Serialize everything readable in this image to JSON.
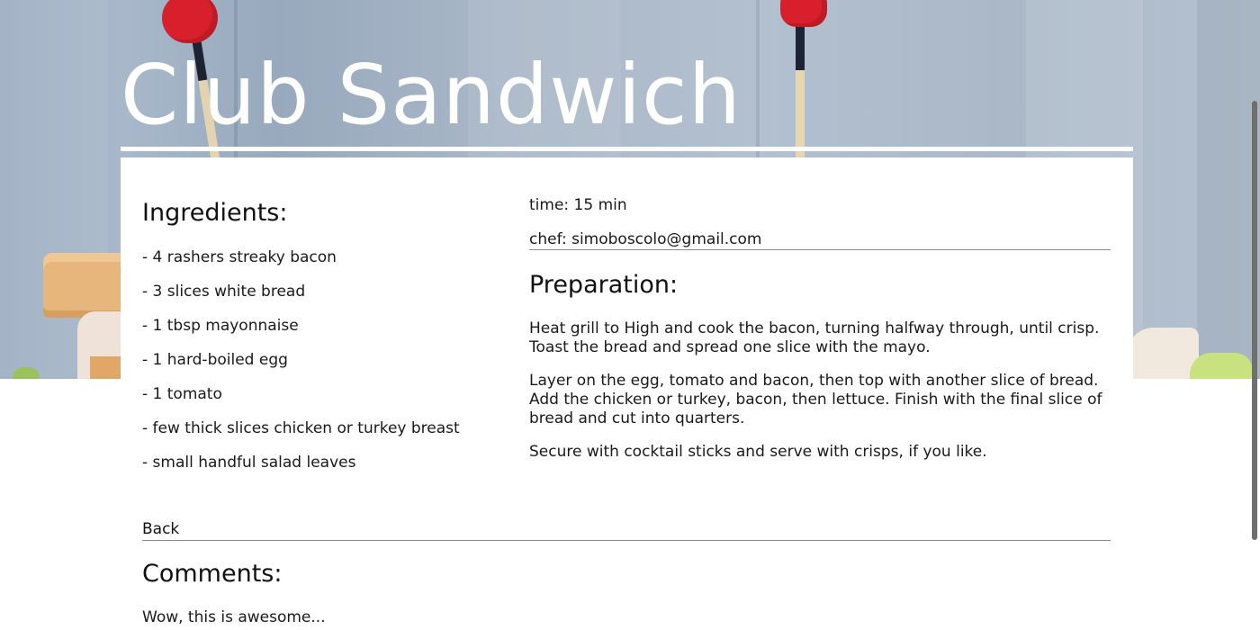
{
  "page": {
    "title": "Club Sandwich"
  },
  "ingredients": {
    "heading": "Ingredients:",
    "items": [
      "- 4 rashers streaky bacon",
      "- 3 slices white bread",
      "- 1 tbsp mayonnaise",
      "- 1 hard-boiled egg",
      "- 1 tomato",
      "- few thick slices chicken or turkey breast",
      "- small handful salad leaves"
    ]
  },
  "meta": {
    "time": "time: 15 min",
    "chef": "chef: simoboscolo@gmail.com"
  },
  "preparation": {
    "heading": "Preparation:",
    "paragraphs": [
      "Heat grill to High and cook the bacon, turning halfway through, until crisp. Toast the bread and spread one slice with the mayo.",
      "Layer on the egg, tomato and bacon, then top with another slice of bread. Add the chicken or turkey, bacon, then lettuce. Finish with the final slice of bread and cut into quarters.",
      "Secure with cocktail sticks and serve with crisps, if you like."
    ]
  },
  "navigation": {
    "back_label": "Back"
  },
  "comments": {
    "heading": "Comments:",
    "items": [
      "Wow, this is awesome..."
    ]
  },
  "colors": {
    "title_text": "#ffffff",
    "body_text": "#111111",
    "rule": "#8a8a8a",
    "hero_tint": "#a8b8ca"
  }
}
